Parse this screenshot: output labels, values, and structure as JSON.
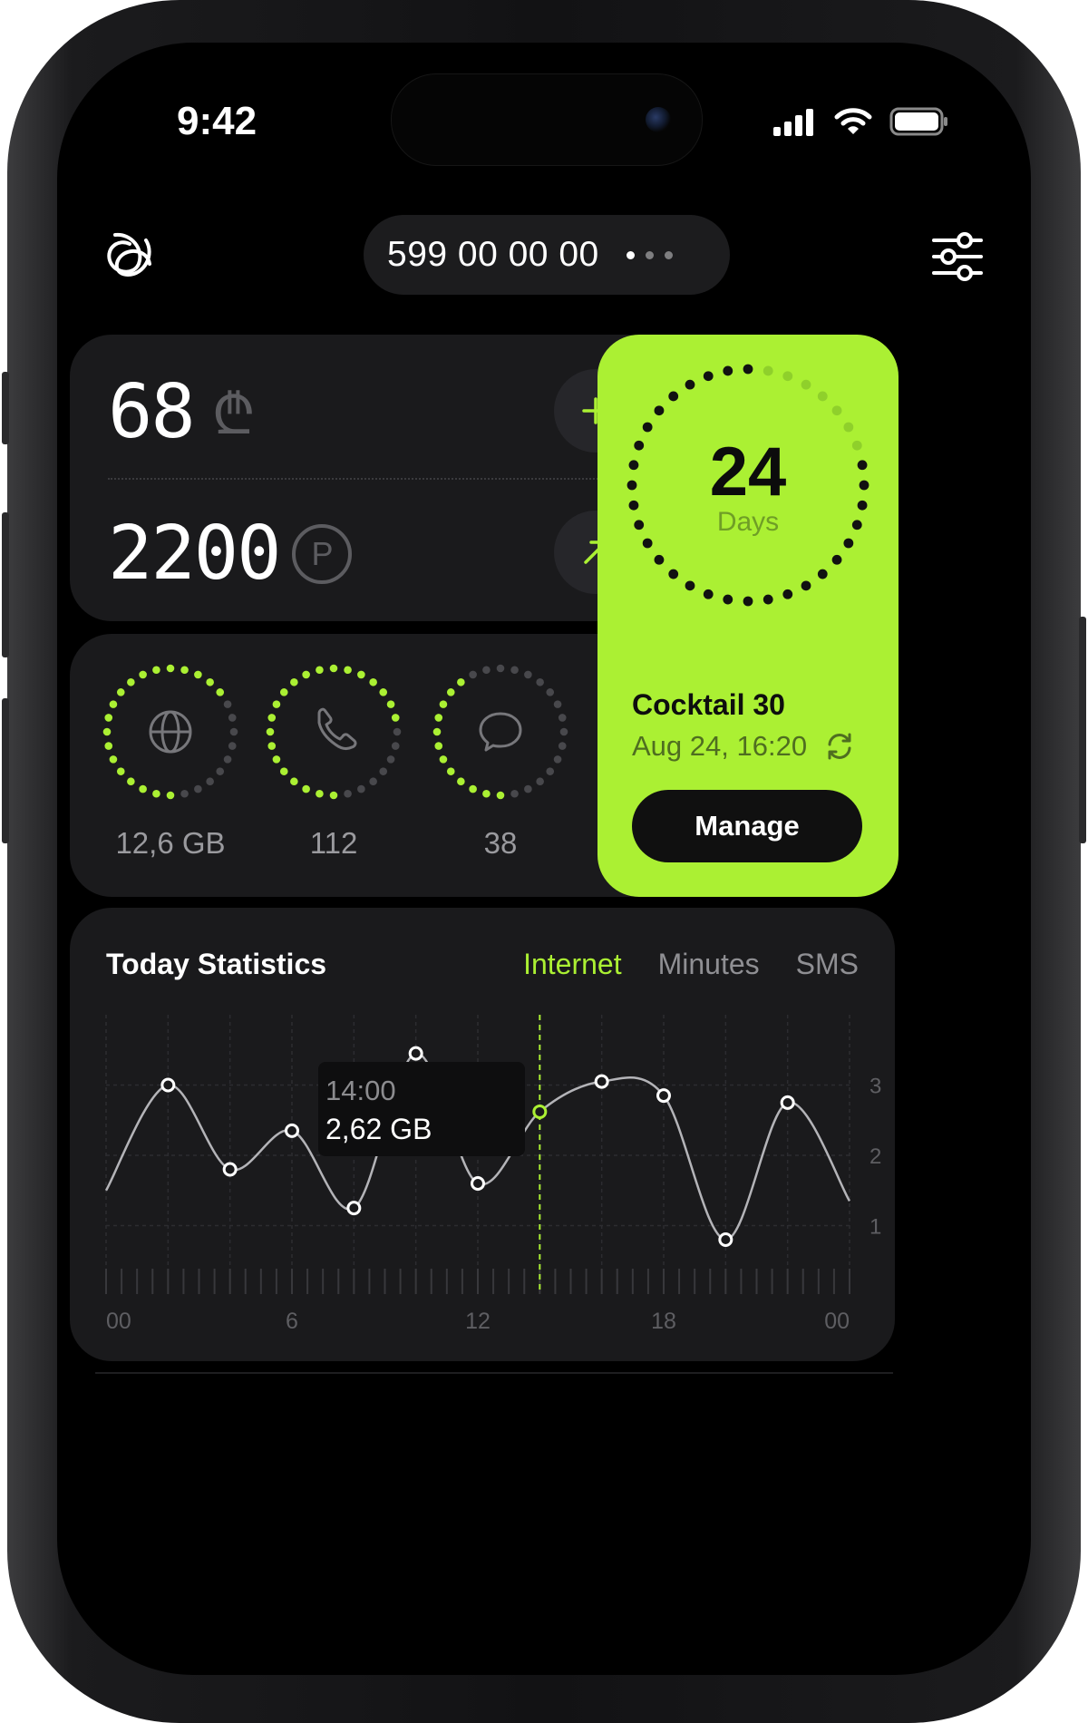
{
  "status_bar": {
    "time": "9:42"
  },
  "header": {
    "phone_number": "599 00 00 00",
    "page_dots": [
      true,
      false,
      false
    ]
  },
  "balance": {
    "money_value": "68",
    "money_currency_symbol": "₾",
    "points_value": "2200",
    "points_symbol": "P"
  },
  "usage": [
    {
      "icon": "globe-icon",
      "value": "12,6 GB",
      "fill": 0.67
    },
    {
      "icon": "phone-icon",
      "value": "112",
      "fill": 0.76
    },
    {
      "icon": "message-icon",
      "value": "38",
      "fill": 0.42
    }
  ],
  "plan": {
    "days": "24",
    "days_label": "Days",
    "days_fill": 0.8,
    "name": "Cocktail 30",
    "renewal_date": "Aug 24, 16:20",
    "manage_label": "Manage"
  },
  "statistics": {
    "title": "Today Statistics",
    "tabs": [
      {
        "label": "Internet",
        "active": true
      },
      {
        "label": "Minutes",
        "active": false
      },
      {
        "label": "SMS",
        "active": false
      }
    ],
    "tooltip": {
      "time": "14:00",
      "value": "2,62 GB"
    }
  },
  "chart_data": {
    "type": "line",
    "x": [
      0,
      2,
      4,
      6,
      8,
      10,
      12,
      14,
      16,
      18,
      20,
      22,
      24
    ],
    "y": [
      1.5,
      3.0,
      1.8,
      2.35,
      1.25,
      3.45,
      1.6,
      2.62,
      3.05,
      2.85,
      0.8,
      2.75,
      1.35
    ],
    "x_tick_labels": [
      "00",
      "6",
      "12",
      "18",
      "00"
    ],
    "x_ticks": [
      0,
      6,
      12,
      18,
      24
    ],
    "y_tick_labels": [
      "3",
      "2",
      "1"
    ],
    "y_ticks": [
      3,
      2,
      1
    ],
    "ylim": [
      0,
      4
    ],
    "xlim": [
      0,
      24
    ],
    "highlight_x": 14,
    "grid": true,
    "line_color": "#b4b4b8",
    "highlight_color": "#abf033"
  },
  "colors": {
    "accent": "#abf033",
    "card": "#1a1a1c",
    "background": "#000000"
  }
}
